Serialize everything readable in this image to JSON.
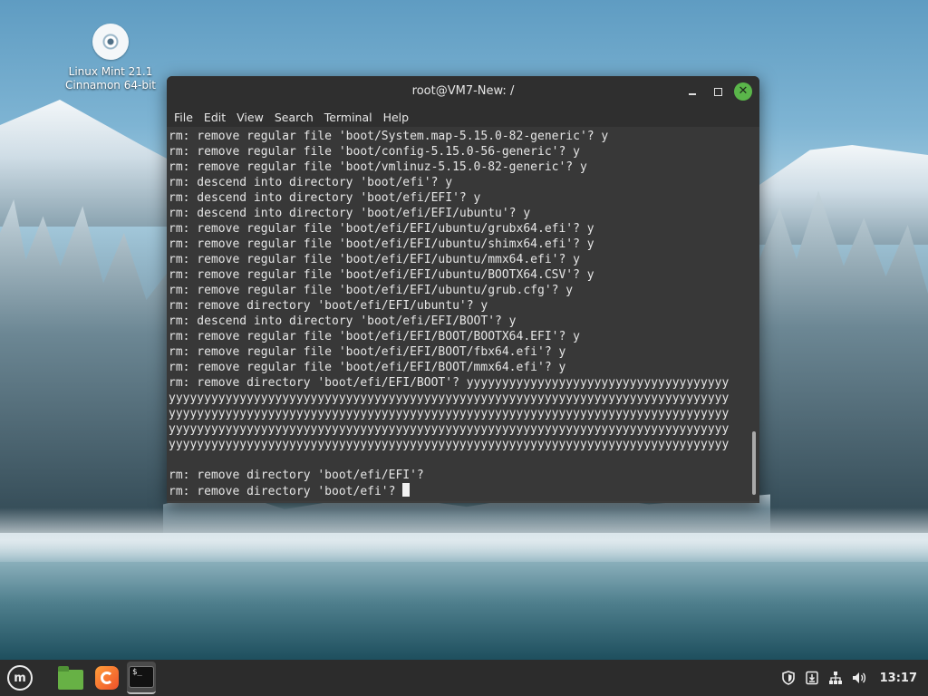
{
  "desktop": {
    "icon_label_line1": "Linux Mint 21.1",
    "icon_label_line2": "Cinnamon 64-bit"
  },
  "window": {
    "title": "root@VM7-New: /",
    "menu": [
      "File",
      "Edit",
      "View",
      "Search",
      "Terminal",
      "Help"
    ]
  },
  "terminal": {
    "lines": [
      "rm: remove regular file 'boot/System.map-5.15.0-82-generic'? y",
      "rm: remove regular file 'boot/config-5.15.0-56-generic'? y",
      "rm: remove regular file 'boot/vmlinuz-5.15.0-82-generic'? y",
      "rm: descend into directory 'boot/efi'? y",
      "rm: descend into directory 'boot/efi/EFI'? y",
      "rm: descend into directory 'boot/efi/EFI/ubuntu'? y",
      "rm: remove regular file 'boot/efi/EFI/ubuntu/grubx64.efi'? y",
      "rm: remove regular file 'boot/efi/EFI/ubuntu/shimx64.efi'? y",
      "rm: remove regular file 'boot/efi/EFI/ubuntu/mmx64.efi'? y",
      "rm: remove regular file 'boot/efi/EFI/ubuntu/BOOTX64.CSV'? y",
      "rm: remove regular file 'boot/efi/EFI/ubuntu/grub.cfg'? y",
      "rm: remove directory 'boot/efi/EFI/ubuntu'? y",
      "rm: descend into directory 'boot/efi/EFI/BOOT'? y",
      "rm: remove regular file 'boot/efi/EFI/BOOT/BOOTX64.EFI'? y",
      "rm: remove regular file 'boot/efi/EFI/BOOT/fbx64.efi'? y",
      "rm: remove regular file 'boot/efi/EFI/BOOT/mmx64.efi'? y",
      "rm: remove directory 'boot/efi/EFI/BOOT'? yyyyyyyyyyyyyyyyyyyyyyyyyyyyyyyyyyyyy",
      "yyyyyyyyyyyyyyyyyyyyyyyyyyyyyyyyyyyyyyyyyyyyyyyyyyyyyyyyyyyyyyyyyyyyyyyyyyyyyyy",
      "yyyyyyyyyyyyyyyyyyyyyyyyyyyyyyyyyyyyyyyyyyyyyyyyyyyyyyyyyyyyyyyyyyyyyyyyyyyyyyy",
      "yyyyyyyyyyyyyyyyyyyyyyyyyyyyyyyyyyyyyyyyyyyyyyyyyyyyyyyyyyyyyyyyyyyyyyyyyyyyyyy",
      "yyyyyyyyyyyyyyyyyyyyyyyyyyyyyyyyyyyyyyyyyyyyyyyyyyyyyyyyyyyyyyyyyyyyyyyyyyyyyyy",
      "",
      "rm: remove directory 'boot/efi/EFI'?"
    ],
    "prompt_line": "rm: remove directory 'boot/efi'? "
  },
  "taskbar": {
    "clock": "13:17",
    "menu_glyph": "m",
    "terminal_glyph": "$_"
  },
  "icons": {
    "desktop": "disc-icon",
    "menu": "mint-menu-icon",
    "files": "folder-icon",
    "browser": "firefox-icon",
    "terminal": "terminal-icon",
    "tray": [
      "shield-icon",
      "update-icon",
      "network-icon",
      "volume-icon"
    ]
  },
  "colors": {
    "window_chrome": "#2f2f2f",
    "terminal_background": "#383838",
    "terminal_text": "#e6e6e6",
    "close_button": "#5ab64a",
    "taskbar": "#2c2c2c"
  }
}
